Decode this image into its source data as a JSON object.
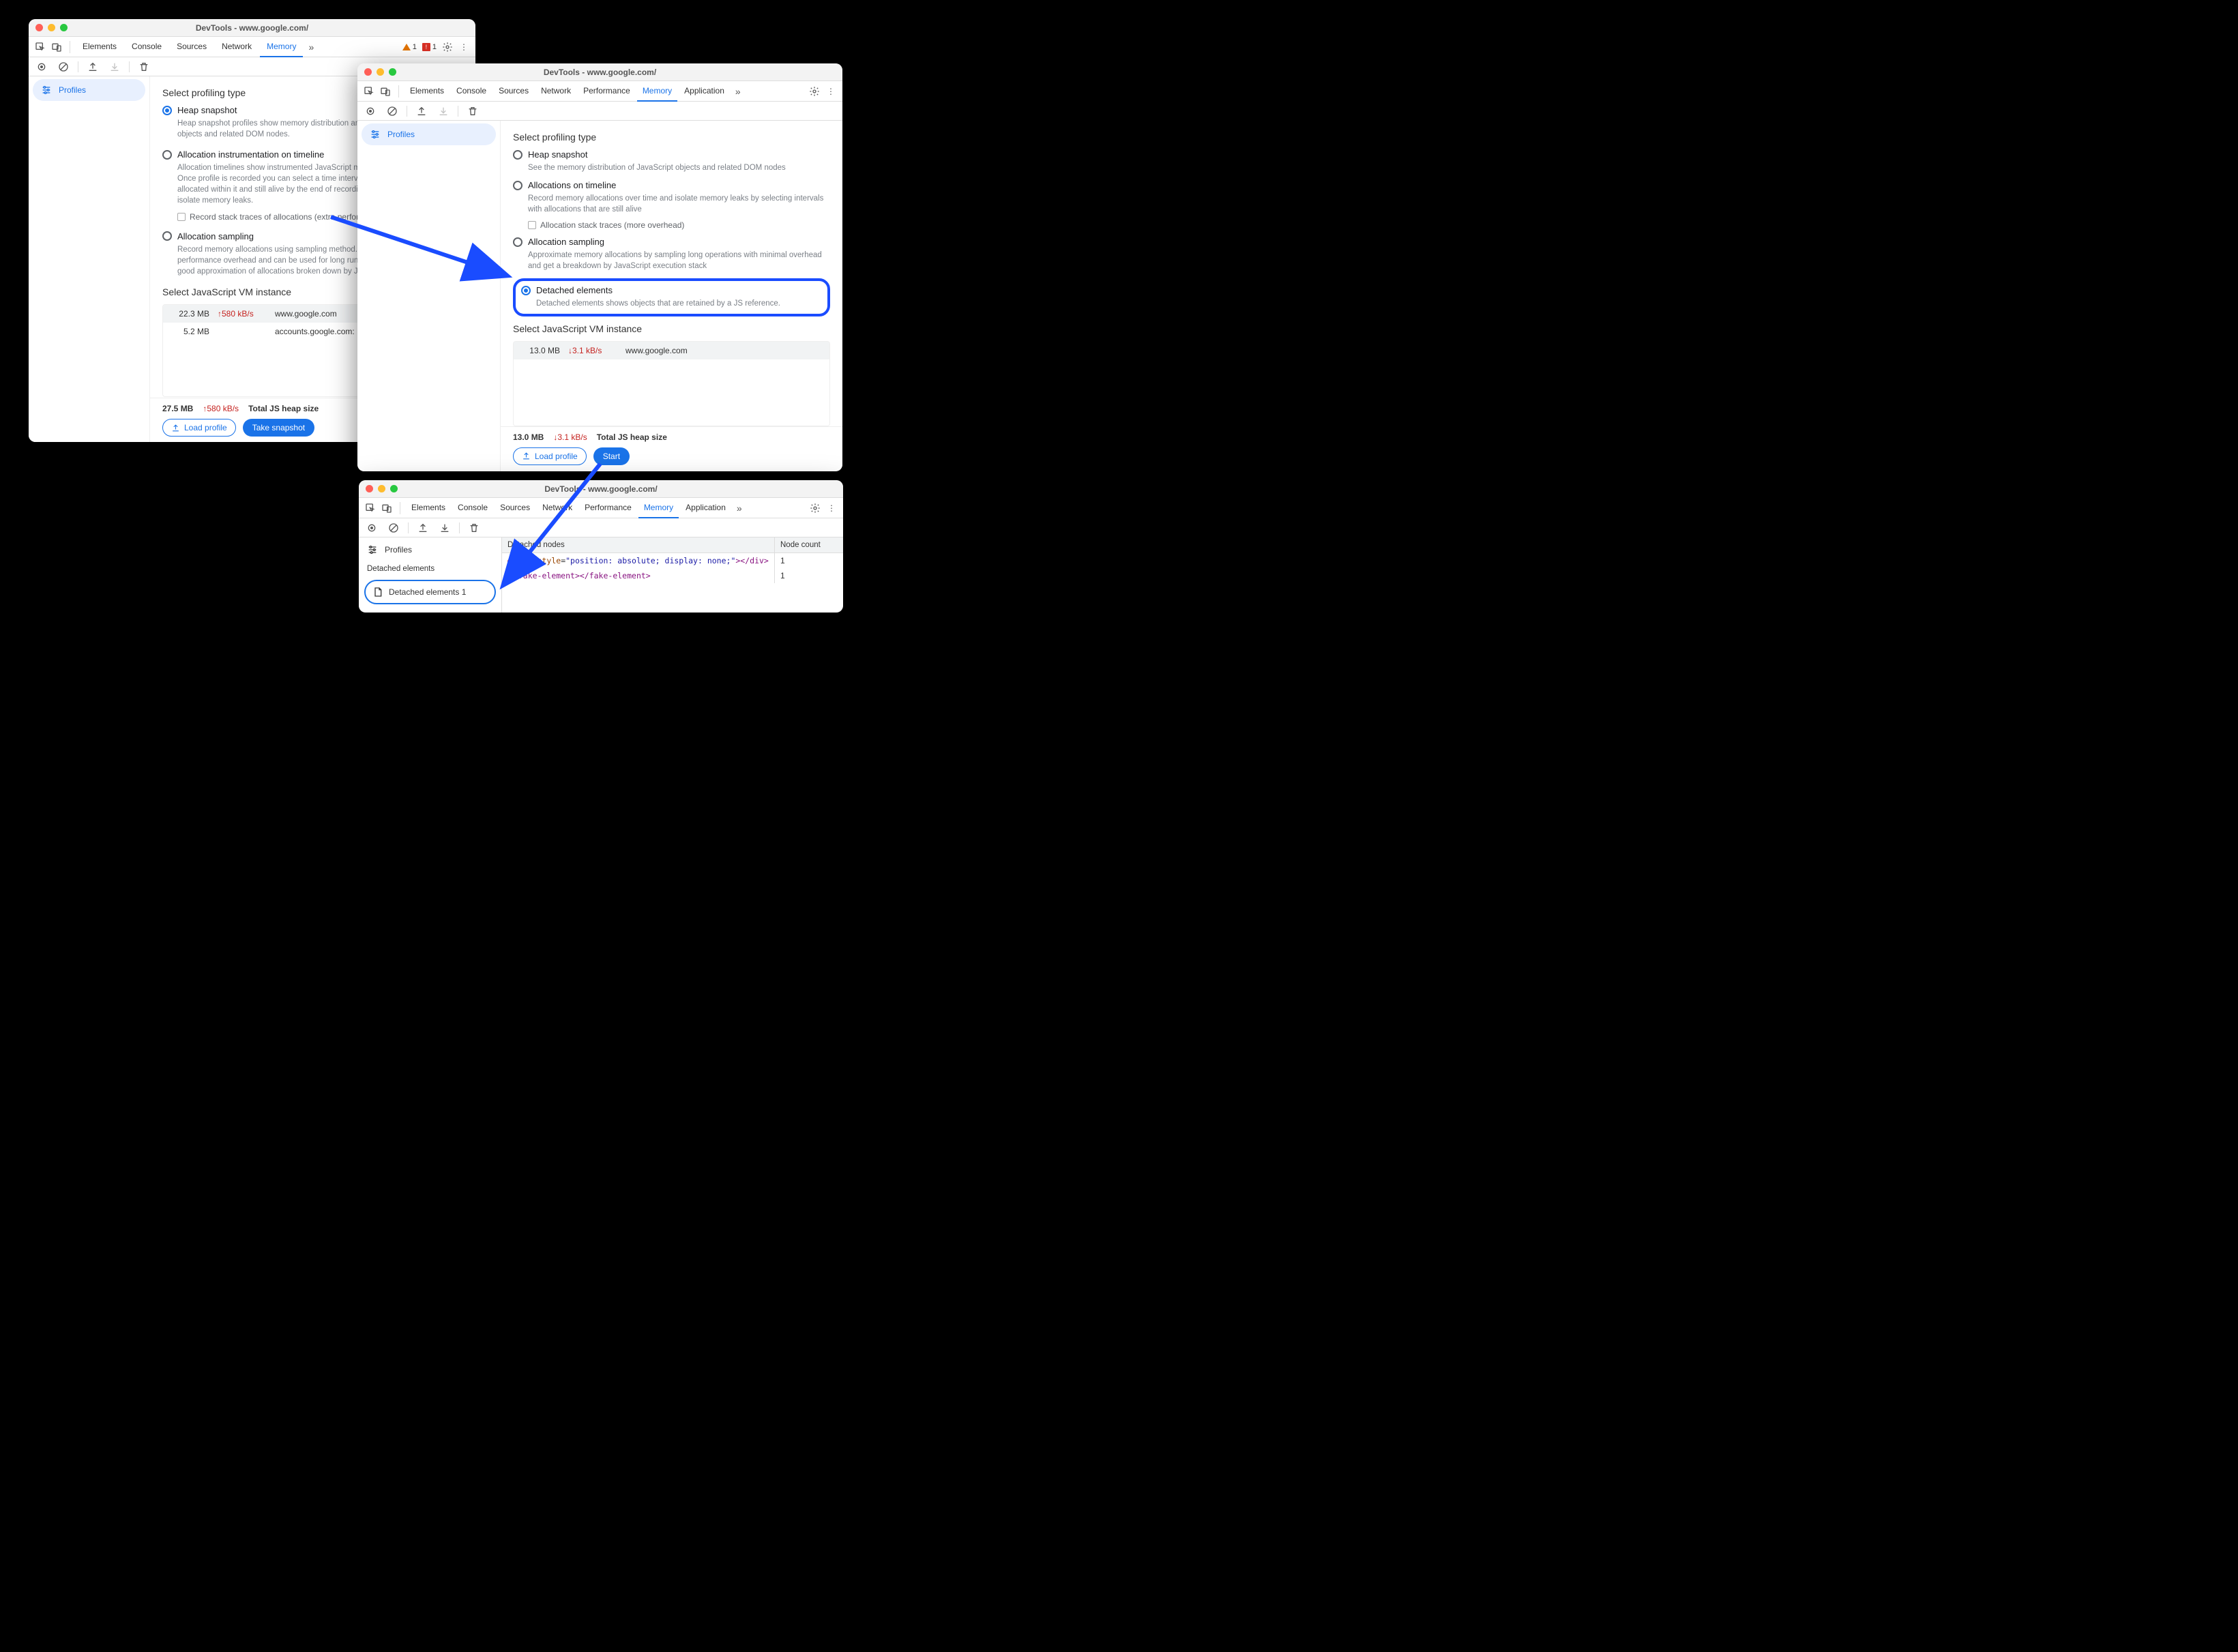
{
  "windows": {
    "w1": {
      "title": "DevTools - www.google.com/",
      "tabs": [
        "Elements",
        "Console",
        "Sources",
        "Network",
        "Memory"
      ],
      "activeTab": "Memory",
      "warnings": {
        "triangle": "1",
        "error": "1"
      },
      "sidebar": {
        "profiles": "Profiles"
      },
      "heading": "Select profiling type",
      "options": [
        {
          "label": "Heap snapshot",
          "desc": "Heap snapshot profiles show memory distribution among your page's JavaScript objects and related DOM nodes.",
          "selected": true
        },
        {
          "label": "Allocation instrumentation on timeline",
          "desc": "Allocation timelines show instrumented JavaScript memory allocations over time. Once profile is recorded you can select a time interval to see objects that were allocated within it and still alive by the end of recording. Use this profile type to isolate memory leaks.",
          "sub": "Record stack traces of allocations (extra performance overhead)"
        },
        {
          "label": "Allocation sampling",
          "desc": "Record memory allocations using sampling method. This profile type has minimal performance overhead and can be used for long running operations. It provides good approximation of allocations broken down by JavaScript execution stack."
        }
      ],
      "vmHeading": "Select JavaScript VM instance",
      "vmRows": [
        {
          "size": "22.3 MB",
          "rate": "580 kB/s",
          "host": "www.google.com",
          "selected": true
        },
        {
          "size": "5.2 MB",
          "rate": "",
          "host": "accounts.google.com: Roaming"
        }
      ],
      "footer": {
        "totalSize": "27.5 MB",
        "rate": "580 kB/s",
        "totalLabel": "Total JS heap size",
        "loadBtn": "Load profile",
        "actionBtn": "Take snapshot"
      }
    },
    "w2": {
      "title": "DevTools - www.google.com/",
      "tabs": [
        "Elements",
        "Console",
        "Sources",
        "Network",
        "Performance",
        "Memory",
        "Application"
      ],
      "activeTab": "Memory",
      "sidebar": {
        "profiles": "Profiles"
      },
      "heading": "Select profiling type",
      "options": [
        {
          "label": "Heap snapshot",
          "desc": "See the memory distribution of JavaScript objects and related DOM nodes"
        },
        {
          "label": "Allocations on timeline",
          "desc": "Record memory allocations over time and isolate memory leaks by selecting intervals with allocations that are still alive",
          "sub": "Allocation stack traces (more overhead)"
        },
        {
          "label": "Allocation sampling",
          "desc": "Approximate memory allocations by sampling long operations with minimal overhead and get a breakdown by JavaScript execution stack"
        },
        {
          "label": "Detached elements",
          "desc": "Detached elements shows objects that are retained by a JS reference.",
          "selected": true,
          "highlighted": true
        }
      ],
      "vmHeading": "Select JavaScript VM instance",
      "vmRows": [
        {
          "size": "13.0 MB",
          "rate": "3.1 kB/s",
          "host": "www.google.com",
          "selected": true
        }
      ],
      "footer": {
        "totalSize": "13.0 MB",
        "rate": "3.1 kB/s",
        "totalLabel": "Total JS heap size",
        "loadBtn": "Load profile",
        "actionBtn": "Start"
      }
    },
    "w3": {
      "title": "DevTools - www.google.com/",
      "tabs": [
        "Elements",
        "Console",
        "Sources",
        "Network",
        "Performance",
        "Memory",
        "Application"
      ],
      "activeTab": "Memory",
      "sidebar": {
        "profiles": "Profiles",
        "section": "Detached elements",
        "selected": "Detached elements 1"
      },
      "gridHeaders": {
        "nodes": "Detached nodes",
        "count": "Node count"
      },
      "rows": [
        {
          "html": "<div style=\"position: absolute; display: none;\"></div>",
          "count": "1"
        },
        {
          "html": "<fake-element></fake-element>",
          "count": "1"
        }
      ]
    }
  }
}
